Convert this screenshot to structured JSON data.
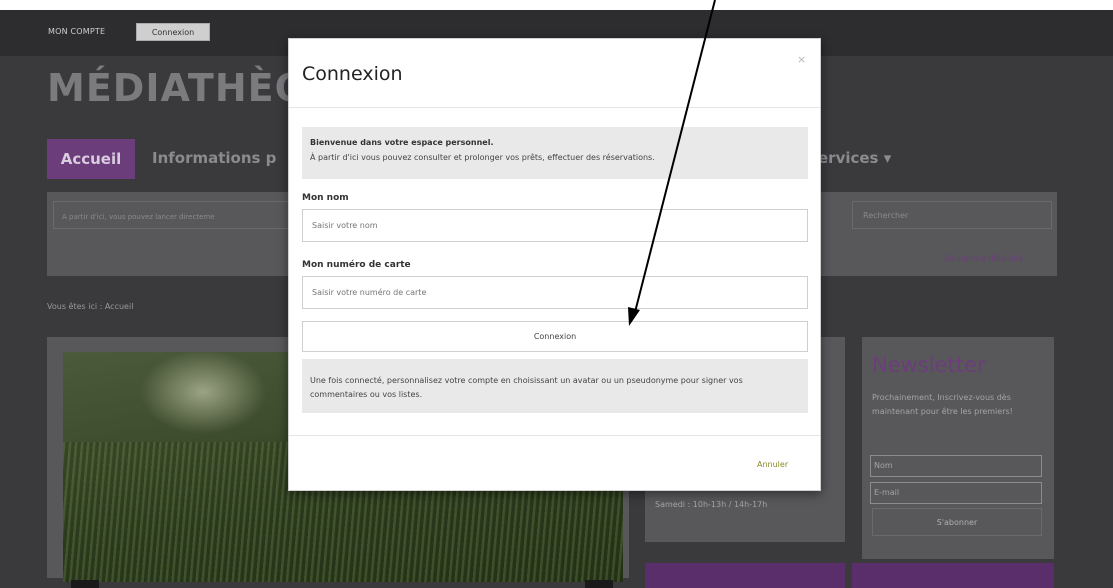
{
  "topbar": {
    "account_label": "MON COMPTE",
    "login_button": "Connexion"
  },
  "site": {
    "title": "MÉDIATHÈQ"
  },
  "nav": {
    "home": "Accueil",
    "info": "Informations p",
    "services": "ervices ▾"
  },
  "search": {
    "hint": "A partir d'ici, vous pouvez lancer directeme",
    "button": "Rechercher",
    "advanced": "Recherche détaillée"
  },
  "breadcrumb": "Vous êtes ici :  Accueil",
  "hours": {
    "saturday": "Samedi :  10h-13h / 14h-17h"
  },
  "newsletter": {
    "title": "Newsletter",
    "text": "Prochainement, Inscrivez-vous dès maintenant pour être les premiers!",
    "name_placeholder": "Nom",
    "email_placeholder": "E-mail",
    "subscribe_button": "S'abonner"
  },
  "modal": {
    "title": "Connexion",
    "close": "×",
    "welcome_title": "Bienvenue dans votre espace personnel.",
    "welcome_text": "À partir d'ici vous pouvez consulter et prolonger vos prêts, effectuer des réservations.",
    "name_label": "Mon nom",
    "name_placeholder": "Saisir votre nom",
    "card_label": "Mon numéro de carte",
    "card_placeholder": "Saisir votre numéro de carte",
    "submit_button": "Connexion",
    "info_text": "Une fois connecté, personnalisez votre compte en choisissant un avatar ou un pseudonyme pour signer vos commentaires ou vos listes.",
    "cancel_button": "Annuler"
  },
  "colors": {
    "brand_purple": "#6b3d7a",
    "overlay_dark": "#3a3a3d",
    "cancel_text": "#8a8a2a"
  }
}
